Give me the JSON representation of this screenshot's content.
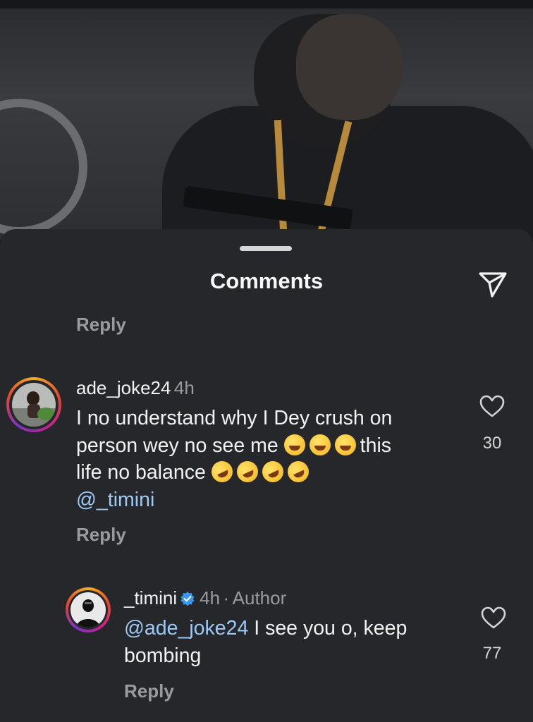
{
  "sheet": {
    "title": "Comments"
  },
  "top_reply": {
    "label": "Reply"
  },
  "comments": [
    {
      "username": "ade_joke24",
      "time": "4h",
      "text_line1": "I no understand why I Dey crush on",
      "text_line2_a": "person wey no see me ",
      "text_line2_b": "this",
      "text_line3": "life no balance ",
      "mention": "@_timini",
      "likes": "30",
      "reply_label": "Reply"
    },
    {
      "username": "_timini",
      "time": "4h",
      "badge": "Author",
      "separator": "·",
      "mention": "@ade_joke24",
      "text_a": " I see you o, keep",
      "text_b": "bombing",
      "likes": "77",
      "reply_label": "Reply"
    }
  ],
  "icons": {
    "share": "paper-plane-icon",
    "like": "heart-outline-icon",
    "verified": "verified-badge-icon"
  },
  "colors": {
    "sheet_bg": "#25272b",
    "mention": "#9ec9f5",
    "muted": "#9a9b9f",
    "verified": "#3897f0"
  }
}
